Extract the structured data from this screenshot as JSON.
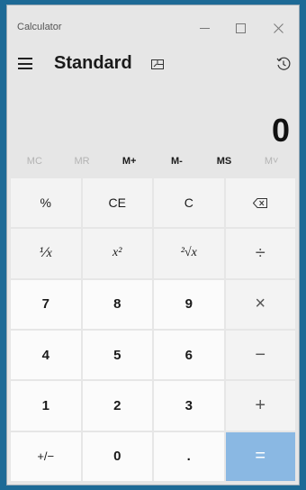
{
  "window": {
    "title": "Calculator",
    "controls": {
      "minimize": "minimize-icon",
      "maximize": "maximize-icon",
      "close": "close-icon"
    }
  },
  "header": {
    "mode": "Standard",
    "menu_icon": "hamburger-icon",
    "keep_on_top_icon": "keep-on-top-icon",
    "history_icon": "history-icon"
  },
  "display": {
    "value": "0"
  },
  "memory": [
    {
      "label": "MC",
      "enabled": false
    },
    {
      "label": "MR",
      "enabled": false
    },
    {
      "label": "M+",
      "enabled": true
    },
    {
      "label": "M-",
      "enabled": true
    },
    {
      "label": "MS",
      "enabled": true
    },
    {
      "label": "M˅",
      "enabled": false
    }
  ],
  "keys": {
    "percent": "%",
    "ce": "CE",
    "c": "C",
    "backspace": "⌫",
    "reciprocal": "⅟x",
    "square": "x²",
    "sqrt": "²√x",
    "divide": "÷",
    "seven": "7",
    "eight": "8",
    "nine": "9",
    "multiply": "×",
    "four": "4",
    "five": "5",
    "six": "6",
    "minus": "−",
    "one": "1",
    "two": "2",
    "three": "3",
    "plus": "+",
    "negate": "+/−",
    "zero": "0",
    "decimal": ".",
    "equals": "="
  },
  "colors": {
    "background": "#1d6a96",
    "window": "#e6e6e6",
    "equals_key": "#8ab8e3",
    "number_key": "#fbfbfb",
    "function_key": "#f3f3f3"
  }
}
